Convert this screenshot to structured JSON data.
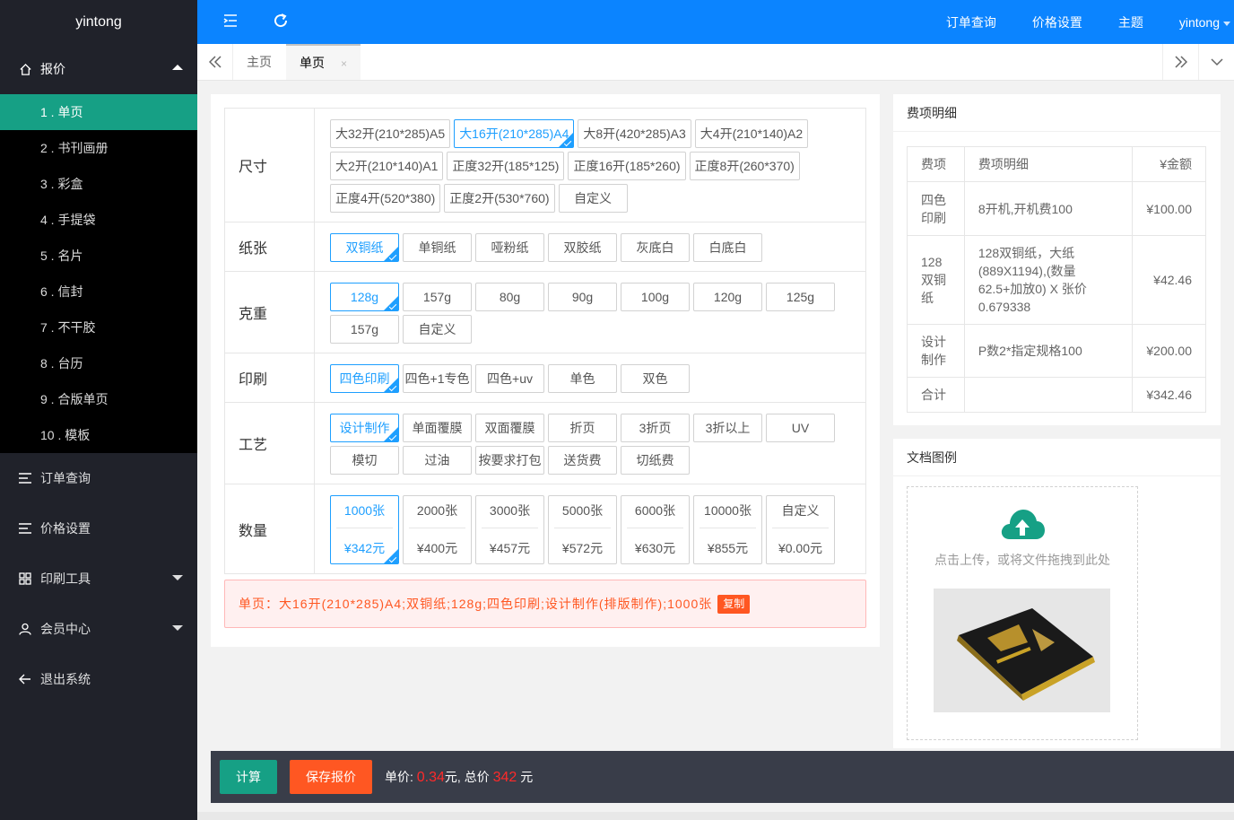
{
  "sidebar": {
    "brand": "yintong",
    "quote_label": "报价",
    "sub_items": [
      "1 . 单页",
      "2 . 书刊画册",
      "3 . 彩盒",
      "4 . 手提袋",
      "5 . 名片",
      "6 . 信封",
      "7 . 不干胶",
      "8 . 台历",
      "9 . 合版单页",
      "10 . 模板"
    ],
    "orders_label": "订单查询",
    "price_label": "价格设置",
    "tools_label": "印刷工具",
    "member_label": "会员中心",
    "logout_label": "退出系统"
  },
  "topbar": {
    "nav": [
      "订单查询",
      "价格设置",
      "主题",
      "yintong"
    ]
  },
  "tabs": {
    "home": "主页",
    "current": "单页",
    "close": "×"
  },
  "options": {
    "size": {
      "label": "尺寸",
      "items": [
        "大32开(210*285)A5",
        "大16开(210*285)A4",
        "大8开(420*285)A3",
        "大4开(210*140)A2",
        "大2开(210*140)A1",
        "正度32开(185*125)",
        "正度16开(185*260)",
        "正度8开(260*370)",
        "正度4开(520*380)",
        "正度2开(530*760)",
        "自定义"
      ]
    },
    "paper": {
      "label": "纸张",
      "items": [
        "双铜纸",
        "单铜纸",
        "哑粉纸",
        "双胶纸",
        "灰底白",
        "白底白"
      ]
    },
    "weight": {
      "label": "克重",
      "items": [
        "128g",
        "157g",
        "80g",
        "90g",
        "100g",
        "120g",
        "125g",
        "157g",
        "自定义"
      ]
    },
    "print": {
      "label": "印刷",
      "items": [
        "四色印刷",
        "四色+1专色",
        "四色+uv",
        "单色",
        "双色"
      ]
    },
    "craft": {
      "label": "工艺",
      "items": [
        "设计制作",
        "单面覆膜",
        "双面覆膜",
        "折页",
        "3折页",
        "3折以上",
        "UV",
        "模切",
        "过油",
        "按要求打包",
        "送货费",
        "切纸费"
      ]
    },
    "quantity": {
      "label": "数量",
      "items": [
        {
          "qty": "1000张",
          "price": "¥342元"
        },
        {
          "qty": "2000张",
          "price": "¥400元"
        },
        {
          "qty": "3000张",
          "price": "¥457元"
        },
        {
          "qty": "5000张",
          "price": "¥572元"
        },
        {
          "qty": "6000张",
          "price": "¥630元"
        },
        {
          "qty": "10000张",
          "price": "¥855元"
        },
        {
          "qty": "自定义",
          "price": "¥0.00元"
        }
      ]
    }
  },
  "summary": {
    "text": "单页：大16开(210*285)A4;双铜纸;128g;四色印刷;设计制作(排版制作);1000张",
    "copy": "复制"
  },
  "fee": {
    "title": "费项明细",
    "headers": [
      "费项",
      "费项明细",
      "¥金额"
    ],
    "rows": [
      {
        "item": "四色印刷",
        "detail": "8开机,开机费100",
        "amount": "¥100.00"
      },
      {
        "item": "128双铜纸",
        "detail": "128双铜纸，大纸(889X1194),(数量62.5+加放0) X 张价0.679338",
        "amount": "¥42.46"
      },
      {
        "item": "设计制作",
        "detail": "P数2*指定规格100",
        "amount": "¥200.00"
      },
      {
        "item": "合计",
        "detail": "",
        "amount": "¥342.46"
      }
    ]
  },
  "doc": {
    "title": "文档图例",
    "upload_hint": "点击上传，或将文件拖拽到此处"
  },
  "bottom": {
    "calc": "计算",
    "save": "保存报价",
    "unit_label": "单价:",
    "unit_value": "0.34",
    "unit_suffix": "元, 总价",
    "total_value": "342",
    "total_suffix": "元"
  },
  "colors": {
    "primary": "#0b84ff",
    "active": "#16a085",
    "selected": "#1e9fff",
    "warn": "#ff5722"
  }
}
